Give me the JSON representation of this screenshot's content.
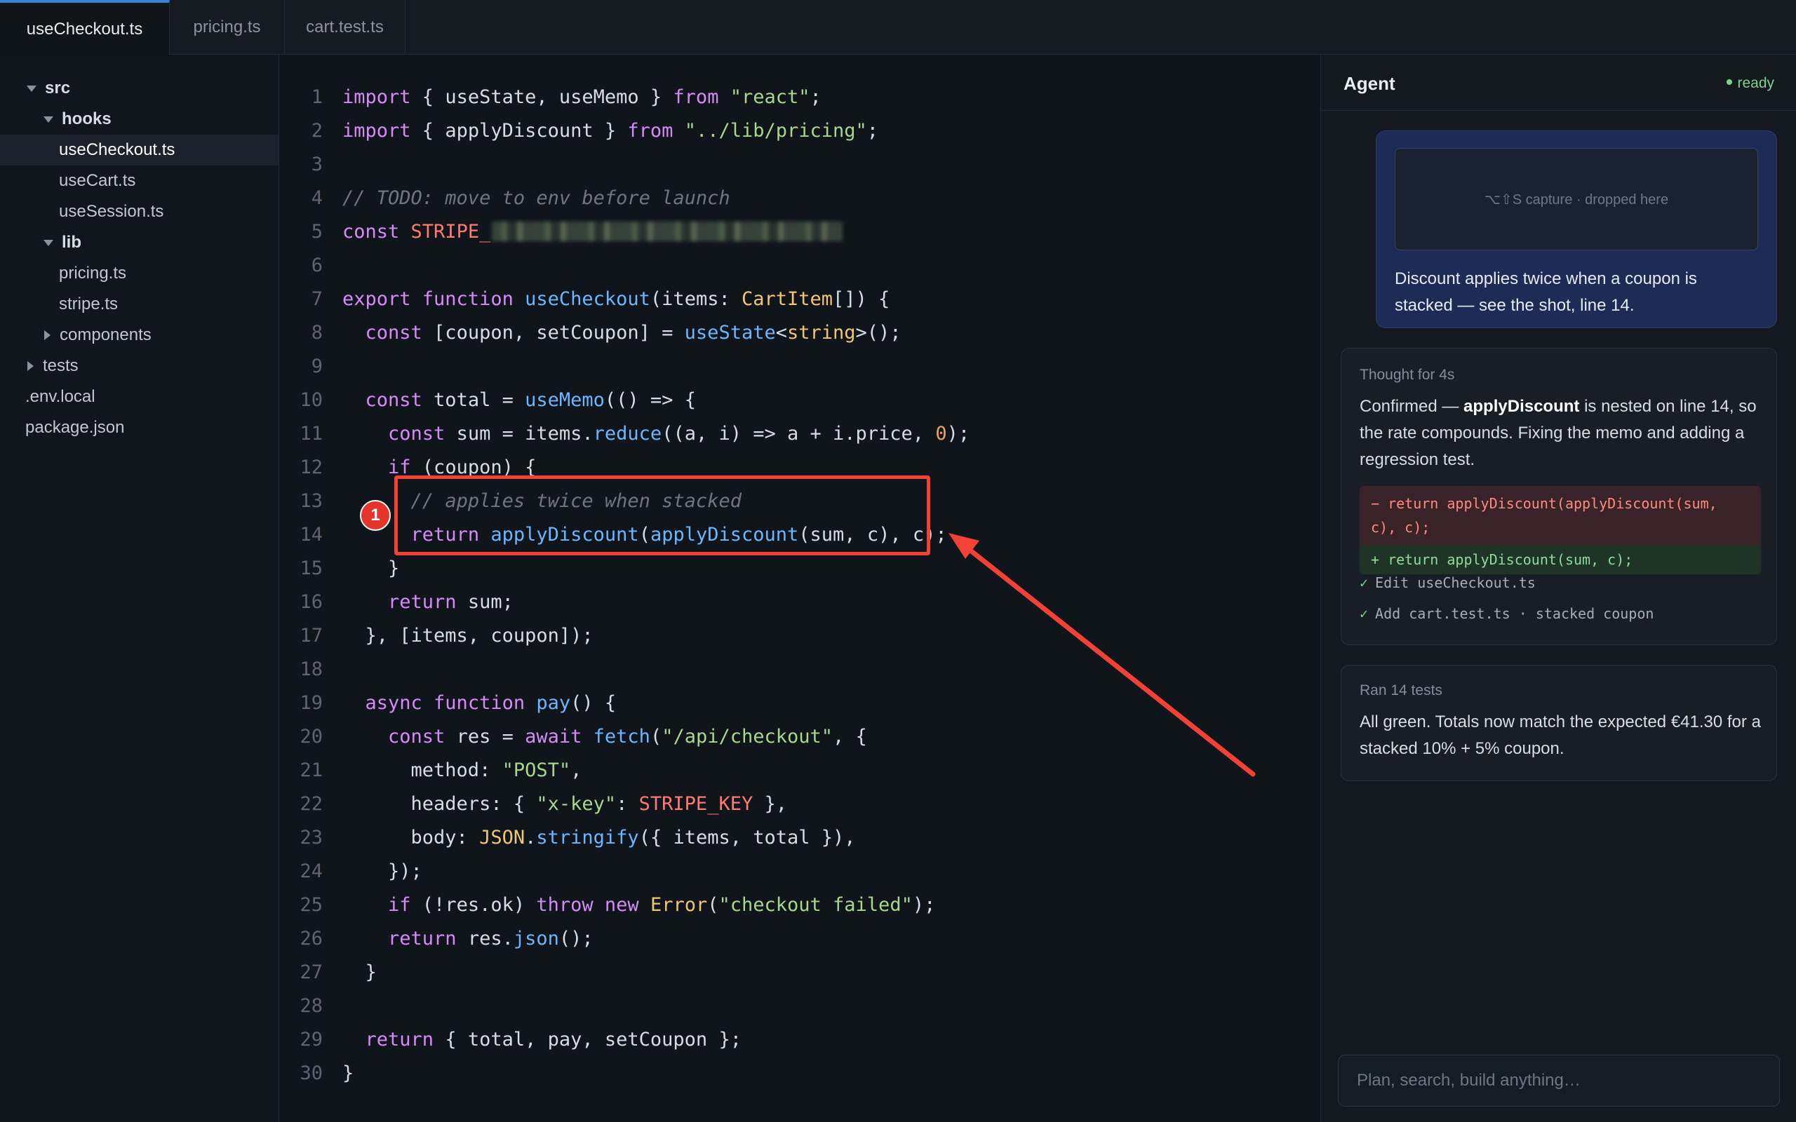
{
  "tabs": [
    {
      "label": "useCheckout.ts",
      "active": true
    },
    {
      "label": "pricing.ts",
      "active": false
    },
    {
      "label": "cart.test.ts",
      "active": false
    }
  ],
  "tree": [
    {
      "label": "src",
      "type": "folder",
      "expanded": true,
      "depth": 0
    },
    {
      "label": "hooks",
      "type": "folder",
      "expanded": true,
      "depth": 1
    },
    {
      "label": "useCheckout.ts",
      "type": "file",
      "depth": 2,
      "selected": true
    },
    {
      "label": "useCart.ts",
      "type": "file",
      "depth": 2
    },
    {
      "label": "useSession.ts",
      "type": "file",
      "depth": 2
    },
    {
      "label": "lib",
      "type": "folder",
      "expanded": true,
      "depth": 1
    },
    {
      "label": "pricing.ts",
      "type": "file",
      "depth": 2
    },
    {
      "label": "stripe.ts",
      "type": "file",
      "depth": 2
    },
    {
      "label": "components",
      "type": "folder",
      "expanded": false,
      "depth": 1
    },
    {
      "label": "tests",
      "type": "folder",
      "expanded": false,
      "depth": 0
    },
    {
      "label": ".env.local",
      "type": "file",
      "depth": 0
    },
    {
      "label": "package.json",
      "type": "file",
      "depth": 0
    }
  ],
  "code": [
    [
      [
        "kw",
        "import"
      ],
      [
        "pl",
        " { useState, useMemo } "
      ],
      [
        "kw",
        "from"
      ],
      [
        "pl",
        " "
      ],
      [
        "str",
        "\"react\""
      ],
      [
        "pl",
        ";"
      ]
    ],
    [
      [
        "kw",
        "import"
      ],
      [
        "pl",
        " { applyDiscount } "
      ],
      [
        "kw",
        "from"
      ],
      [
        "pl",
        " "
      ],
      [
        "str",
        "\"../lib/pricing\""
      ],
      [
        "pl",
        ";"
      ]
    ],
    [],
    [
      [
        "cm",
        "// TODO: move to env before launch"
      ]
    ],
    [
      [
        "kw",
        "const"
      ],
      [
        "pl",
        " "
      ],
      [
        "con",
        "STRIPE_"
      ],
      [
        "blur",
        ""
      ]
    ],
    [],
    [
      [
        "kw",
        "export function"
      ],
      [
        "pl",
        " "
      ],
      [
        "fn",
        "useCheckout"
      ],
      [
        "pl",
        "(items: "
      ],
      [
        "ty",
        "CartItem"
      ],
      [
        "pl",
        "[]) {"
      ]
    ],
    [
      [
        "pl",
        "  "
      ],
      [
        "kw",
        "const"
      ],
      [
        "pl",
        " [coupon, setCoupon] = "
      ],
      [
        "fn",
        "useState"
      ],
      [
        "pl",
        "<"
      ],
      [
        "ty",
        "string"
      ],
      [
        "pl",
        ">();"
      ]
    ],
    [],
    [
      [
        "pl",
        "  "
      ],
      [
        "kw",
        "const"
      ],
      [
        "pl",
        " total = "
      ],
      [
        "fn",
        "useMemo"
      ],
      [
        "pl",
        "(() => {"
      ]
    ],
    [
      [
        "pl",
        "    "
      ],
      [
        "kw",
        "const"
      ],
      [
        "pl",
        " sum = items."
      ],
      [
        "fn",
        "reduce"
      ],
      [
        "pl",
        "((a, i) => a + i.price, "
      ],
      [
        "num",
        "0"
      ],
      [
        "pl",
        ");"
      ]
    ],
    [
      [
        "pl",
        "    "
      ],
      [
        "kw",
        "if"
      ],
      [
        "pl",
        " (coupon) {"
      ]
    ],
    [
      [
        "pl",
        "      "
      ],
      [
        "cm",
        "// applies twice when stacked"
      ]
    ],
    [
      [
        "pl",
        "      "
      ],
      [
        "kw",
        "return"
      ],
      [
        "pl",
        " "
      ],
      [
        "fn",
        "applyDiscount"
      ],
      [
        "pl",
        "("
      ],
      [
        "fn",
        "applyDiscount"
      ],
      [
        "pl",
        "(sum, c), c);"
      ]
    ],
    [
      [
        "pl",
        "    }"
      ]
    ],
    [
      [
        "pl",
        "    "
      ],
      [
        "kw",
        "return"
      ],
      [
        "pl",
        " sum;"
      ]
    ],
    [
      [
        "pl",
        "  }, [items, coupon]);"
      ]
    ],
    [],
    [
      [
        "pl",
        "  "
      ],
      [
        "kw",
        "async function"
      ],
      [
        "pl",
        " "
      ],
      [
        "fn",
        "pay"
      ],
      [
        "pl",
        "() {"
      ]
    ],
    [
      [
        "pl",
        "    "
      ],
      [
        "kw",
        "const"
      ],
      [
        "pl",
        " res = "
      ],
      [
        "kw",
        "await"
      ],
      [
        "pl",
        " "
      ],
      [
        "fn",
        "fetch"
      ],
      [
        "pl",
        "("
      ],
      [
        "str",
        "\"/api/checkout\""
      ],
      [
        "pl",
        ", {"
      ]
    ],
    [
      [
        "pl",
        "      method: "
      ],
      [
        "str",
        "\"POST\""
      ],
      [
        "pl",
        ","
      ]
    ],
    [
      [
        "pl",
        "      headers: { "
      ],
      [
        "str",
        "\"x-key\""
      ],
      [
        "pl",
        ": "
      ],
      [
        "con",
        "STRIPE_KEY"
      ],
      [
        "pl",
        " },"
      ]
    ],
    [
      [
        "pl",
        "      body: "
      ],
      [
        "ty",
        "JSON"
      ],
      [
        "pl",
        "."
      ],
      [
        "fn",
        "stringify"
      ],
      [
        "pl",
        "({ items, total }),"
      ]
    ],
    [
      [
        "pl",
        "    });"
      ]
    ],
    [
      [
        "pl",
        "    "
      ],
      [
        "kw",
        "if"
      ],
      [
        "pl",
        " (!res.ok) "
      ],
      [
        "kw",
        "throw new"
      ],
      [
        "pl",
        " "
      ],
      [
        "ty",
        "Error"
      ],
      [
        "pl",
        "("
      ],
      [
        "str",
        "\"checkout failed\""
      ],
      [
        "pl",
        ");"
      ]
    ],
    [
      [
        "pl",
        "    "
      ],
      [
        "kw",
        "return"
      ],
      [
        "pl",
        " res."
      ],
      [
        "fn",
        "json"
      ],
      [
        "pl",
        "();"
      ]
    ],
    [
      [
        "pl",
        "  }"
      ]
    ],
    [],
    [
      [
        "pl",
        "  "
      ],
      [
        "kw",
        "return"
      ],
      [
        "pl",
        " { total, pay, setCoupon };"
      ]
    ],
    [
      [
        "pl",
        "}"
      ]
    ]
  ],
  "annotation": {
    "badge": "1",
    "color": "#f24236"
  },
  "agent": {
    "title": "Agent",
    "status": "ready",
    "user_message": {
      "capture_label": "⌥⇧S capture · dropped here",
      "text": "Discount applies twice when a coupon is stacked — see the shot, line 14."
    },
    "thought": {
      "meta": "Thought for 4s",
      "text_pre": "Confirmed — ",
      "text_bold": "applyDiscount",
      "text_post": " is nested on line 14, so the rate compounds. Fixing the memo and adding a regression test.",
      "diff_removed": "− return applyDiscount(applyDiscount(sum, c), c);",
      "diff_added": "+ return applyDiscount(sum, c);",
      "steps": [
        "Edit useCheckout.ts",
        "Add cart.test.ts · stacked coupon"
      ]
    },
    "tests": {
      "meta": "Ran 14 tests",
      "text": "All green. Totals now match the expected €41.30 for a stacked 10% + 5% coupon."
    },
    "composer_placeholder": "Plan, search, build anything…"
  },
  "colors": {
    "accent": "#3f7fd8",
    "user_bubble": "#1f2b57",
    "success": "#7ed28a",
    "danger": "#f24236"
  }
}
